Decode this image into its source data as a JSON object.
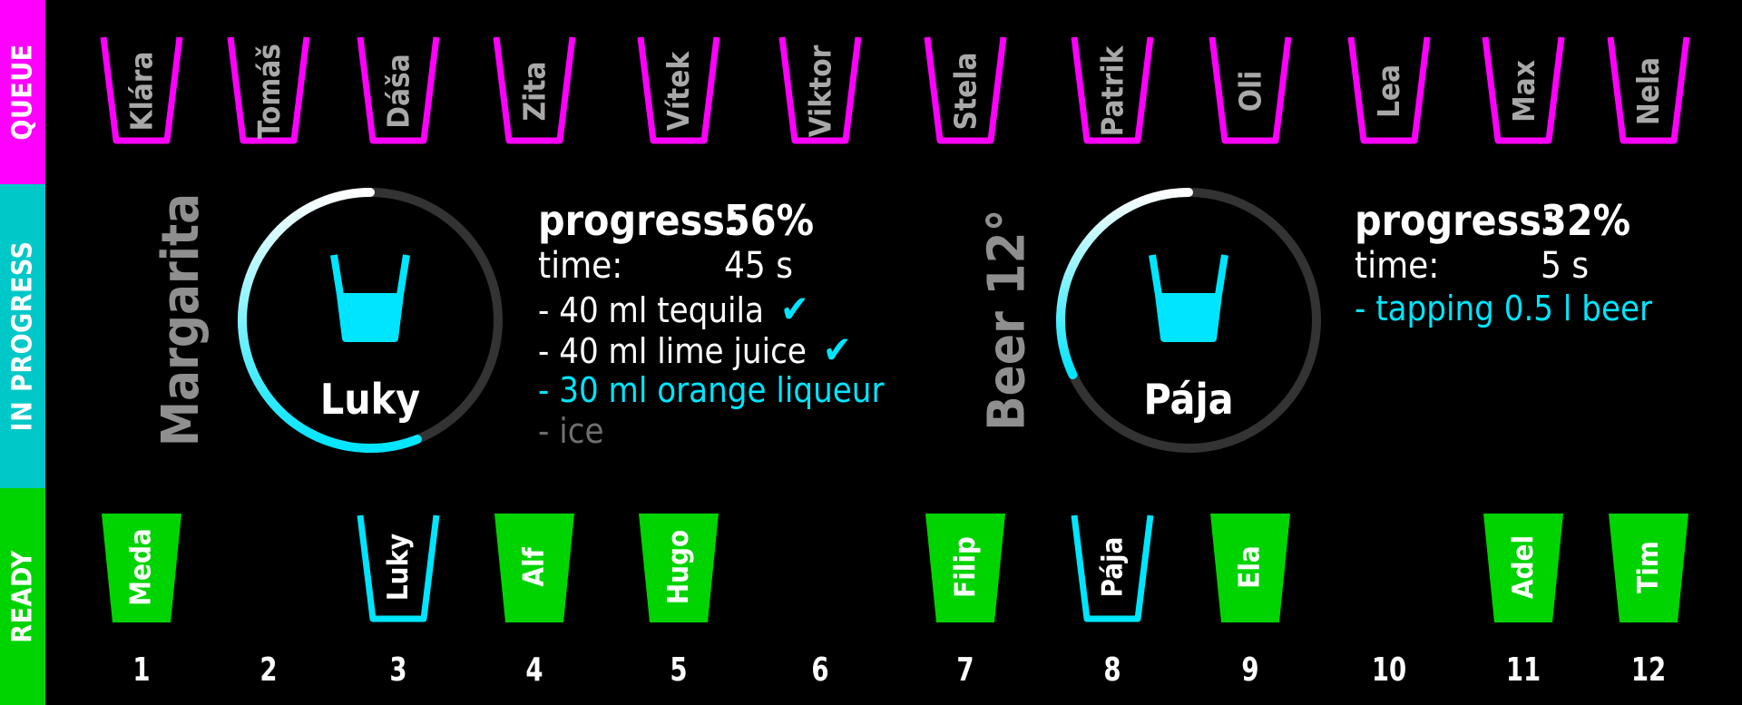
{
  "sections": {
    "queue": "QUEUE",
    "in_progress": "IN PROGRESS",
    "ready": "READY"
  },
  "colors": {
    "queue": "#ff00ff",
    "in_progress": "#00c8c8",
    "ready": "#00d400",
    "accent": "#00e5ff"
  },
  "queue": [
    "Klára",
    "Tomáš",
    "Dáša",
    "Zita",
    "Vítek",
    "Viktor",
    "Stela",
    "Patrik",
    "Oli",
    "Lea",
    "Max",
    "Nela"
  ],
  "ready_slots": [
    {
      "number": "1",
      "name": "Meda",
      "state": "ready"
    },
    {
      "number": "2",
      "name": "",
      "state": "empty"
    },
    {
      "number": "3",
      "name": "Luky",
      "state": "in-progress"
    },
    {
      "number": "4",
      "name": "Alf",
      "state": "ready"
    },
    {
      "number": "5",
      "name": "Hugo",
      "state": "ready"
    },
    {
      "number": "6",
      "name": "",
      "state": "empty"
    },
    {
      "number": "7",
      "name": "Filip",
      "state": "ready"
    },
    {
      "number": "8",
      "name": "Pája",
      "state": "in-progress"
    },
    {
      "number": "9",
      "name": "Ela",
      "state": "ready"
    },
    {
      "number": "10",
      "name": "",
      "state": "empty"
    },
    {
      "number": "11",
      "name": "Adel",
      "state": "ready"
    },
    {
      "number": "12",
      "name": "Tim",
      "state": "ready"
    }
  ],
  "in_progress": [
    {
      "drink": "Margarita",
      "person": "Luky",
      "progress_label": "progress:",
      "progress_text": "56%",
      "progress": 0.56,
      "time_label": "time:",
      "time": "45 s",
      "steps": [
        {
          "text": "- 40 ml tequila",
          "state": "done"
        },
        {
          "text": "- 40 ml lime juice",
          "state": "done"
        },
        {
          "text": "- 30 ml orange liqueur",
          "state": "active"
        },
        {
          "text": "- ice",
          "state": "pending"
        }
      ]
    },
    {
      "drink": "Beer 12°",
      "person": "Pája",
      "progress_label": "progress:",
      "progress_text": "32%",
      "progress": 0.32,
      "time_label": "time:",
      "time": "5 s",
      "steps": [
        {
          "text": "- tapping 0.5 l beer",
          "state": "active"
        }
      ]
    }
  ]
}
